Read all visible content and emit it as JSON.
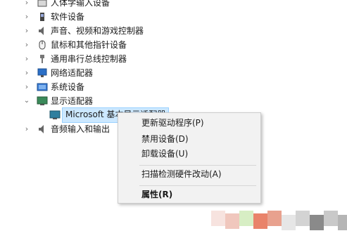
{
  "device_tree": {
    "items": [
      {
        "label": "人体学输入设备",
        "icon": "hid-icon",
        "state": "collapsed"
      },
      {
        "label": "软件设备",
        "icon": "software-device-icon",
        "state": "collapsed"
      },
      {
        "label": "声音、视频和游戏控制器",
        "icon": "speaker-icon",
        "state": "collapsed"
      },
      {
        "label": "鼠标和其他指针设备",
        "icon": "mouse-icon",
        "state": "collapsed"
      },
      {
        "label": "通用串行总线控制器",
        "icon": "usb-icon",
        "state": "collapsed"
      },
      {
        "label": "网络适配器",
        "icon": "network-icon",
        "state": "collapsed"
      },
      {
        "label": "系统设备",
        "icon": "system-icon",
        "state": "collapsed"
      },
      {
        "label": "显示适配器",
        "icon": "display-icon",
        "state": "expanded"
      },
      {
        "label": "Microsoft 基本显示适配器",
        "icon": "monitor-icon",
        "state": "selected-child"
      },
      {
        "label": "音频输入和输出",
        "icon": "speaker-icon",
        "state": "collapsed"
      }
    ]
  },
  "context_menu": {
    "update_driver": "更新驱动程序(P)",
    "disable_device": "禁用设备(D)",
    "uninstall_device": "卸载设备(U)",
    "scan_hardware": "扫描检测硬件改动(A)",
    "properties": "属性(R)"
  },
  "colors": {
    "selection_bg": "#cce8ff",
    "selection_border": "#99d1ff",
    "menu_bg": "#f2f2f2"
  }
}
